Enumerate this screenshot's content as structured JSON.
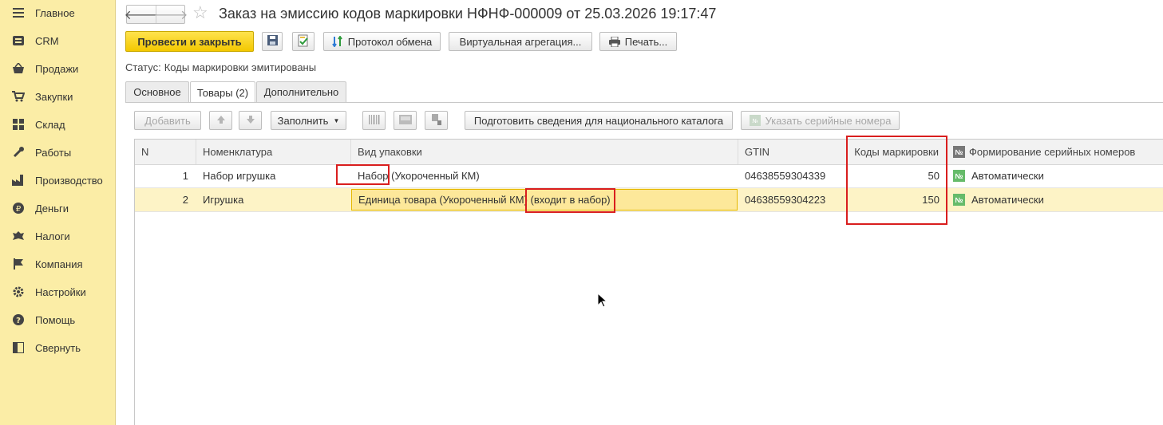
{
  "sidebar": {
    "items": [
      {
        "label": "Главное",
        "icon": "menu-icon"
      },
      {
        "label": "CRM",
        "icon": "crm-icon"
      },
      {
        "label": "Продажи",
        "icon": "basket-icon"
      },
      {
        "label": "Закупки",
        "icon": "cart-icon"
      },
      {
        "label": "Склад",
        "icon": "warehouse-icon"
      },
      {
        "label": "Работы",
        "icon": "tools-icon"
      },
      {
        "label": "Производство",
        "icon": "factory-icon"
      },
      {
        "label": "Деньги",
        "icon": "ruble-icon"
      },
      {
        "label": "Налоги",
        "icon": "emblem-icon"
      },
      {
        "label": "Компания",
        "icon": "flag-icon"
      },
      {
        "label": "Настройки",
        "icon": "gear-icon"
      },
      {
        "label": "Помощь",
        "icon": "help-icon"
      },
      {
        "label": "Свернуть",
        "icon": "collapse-icon"
      }
    ]
  },
  "header": {
    "title": "Заказ на эмиссию кодов маркировки НФНФ-000009 от 25.03.2026 19:17:47"
  },
  "toolbar": {
    "post_close": "Провести и закрыть",
    "exchange_protocol": "Протокол обмена",
    "virtual_aggregation": "Виртуальная агрегация...",
    "print": "Печать..."
  },
  "status": {
    "label": "Статус:",
    "value": "Коды маркировки эмитированы"
  },
  "tabs": [
    {
      "label": "Основное",
      "active": false
    },
    {
      "label": "Товары (2)",
      "active": true
    },
    {
      "label": "Дополнительно",
      "active": false
    }
  ],
  "table_toolbar": {
    "add": "Добавить",
    "fill": "Заполнить",
    "prepare_catalog": "Подготовить сведения для национального каталога",
    "serial_numbers": "Указать серийные номера"
  },
  "table": {
    "columns": [
      "N",
      "Номенклатура",
      "Вид упаковки",
      "GTIN",
      "Коды маркировки",
      "Формирование серийных номеров"
    ],
    "rows": [
      {
        "n": "1",
        "item": "Набор игрушка",
        "pack_main": "Набор",
        "pack_rest": "(Укороченный КМ)",
        "gtin": "04638559304339",
        "codes": "50",
        "serial": "Автоматически"
      },
      {
        "n": "2",
        "item": "Игрушка",
        "pack_main": "Единица товара (Укороченный КМ)",
        "pack_rest": "(входит в набор)",
        "gtin": "04638559304223",
        "codes": "150",
        "serial": "Автоматически"
      }
    ]
  },
  "colors": {
    "sidebar_bg": "#fbeda6",
    "primary_button": "#f3c800",
    "selected_row": "#fdf3c6",
    "highlight": "#d91e1e"
  }
}
